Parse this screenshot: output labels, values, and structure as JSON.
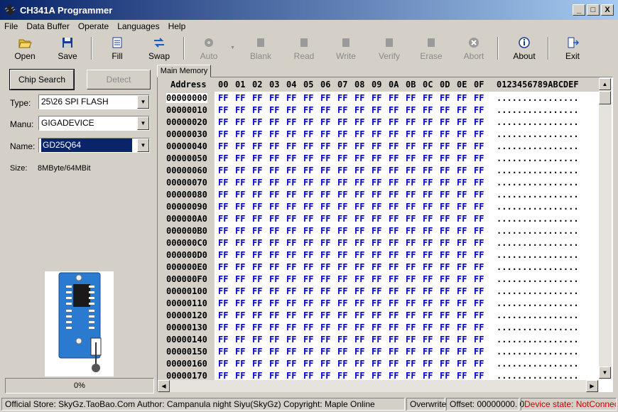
{
  "window": {
    "title": "CH341A Programmer",
    "buttons": [
      "_",
      "□",
      "X"
    ]
  },
  "menu": [
    "File",
    "Data Buffer",
    "Operate",
    "Languages",
    "Help"
  ],
  "toolbar": [
    {
      "label": "Open",
      "icon": "folder-open-icon",
      "enabled": true
    },
    {
      "label": "Save",
      "icon": "floppy-save-icon",
      "enabled": true
    },
    {
      "label": "Fill",
      "icon": "fill-icon",
      "enabled": true
    },
    {
      "label": "Swap",
      "icon": "swap-arrows-icon",
      "enabled": true
    },
    {
      "label": "Auto",
      "icon": "auto-gear-icon",
      "enabled": false
    },
    {
      "label": "Blank",
      "icon": "blank-chip-icon",
      "enabled": false
    },
    {
      "label": "Read",
      "icon": "read-chip-icon",
      "enabled": false
    },
    {
      "label": "Write",
      "icon": "write-chip-icon",
      "enabled": false
    },
    {
      "label": "Verify",
      "icon": "verify-chip-icon",
      "enabled": false
    },
    {
      "label": "Erase",
      "icon": "erase-chip-icon",
      "enabled": false
    },
    {
      "label": "Abort",
      "icon": "abort-icon",
      "enabled": false
    },
    {
      "label": "About",
      "icon": "info-icon",
      "enabled": true
    },
    {
      "label": "Exit",
      "icon": "exit-door-icon",
      "enabled": true
    }
  ],
  "left": {
    "chip_search": "Chip Search",
    "detect": "Detect",
    "type_label": "Type:",
    "type_value": "25\\26 SPI FLASH",
    "manu_label": "Manu:",
    "manu_value": "GIGADEVICE",
    "name_label": "Name:",
    "name_value": "GD25Q64",
    "size_label": "Size:",
    "size_value": "8MByte/64MBit",
    "progress": "0%"
  },
  "tab": "Main Memory",
  "hex": {
    "address_header": "Address",
    "columns": [
      "00",
      "01",
      "02",
      "03",
      "04",
      "05",
      "06",
      "07",
      "08",
      "09",
      "0A",
      "0B",
      "0C",
      "0D",
      "0E",
      "0F"
    ],
    "ascii_header": "0123456789ABCDEF",
    "rows": [
      "00000000",
      "00000010",
      "00000020",
      "00000030",
      "00000040",
      "00000050",
      "00000060",
      "00000070",
      "00000080",
      "00000090",
      "000000A0",
      "000000B0",
      "000000C0",
      "000000D0",
      "000000E0",
      "000000F0",
      "00000100",
      "00000110",
      "00000120",
      "00000130",
      "00000140",
      "00000150",
      "00000160",
      "00000170"
    ],
    "byte": "FF",
    "ascii": "................"
  },
  "status": {
    "store": "Official Store: SkyGz.TaoBao.Com Author: Campanula night Siyu(SkyGz) Copyright: Maple Online",
    "mode": "Overwrite",
    "offset": "Offset: 00000000. 0",
    "device_state": "Device state: NotConnect",
    "device_color": "#cc0000"
  }
}
